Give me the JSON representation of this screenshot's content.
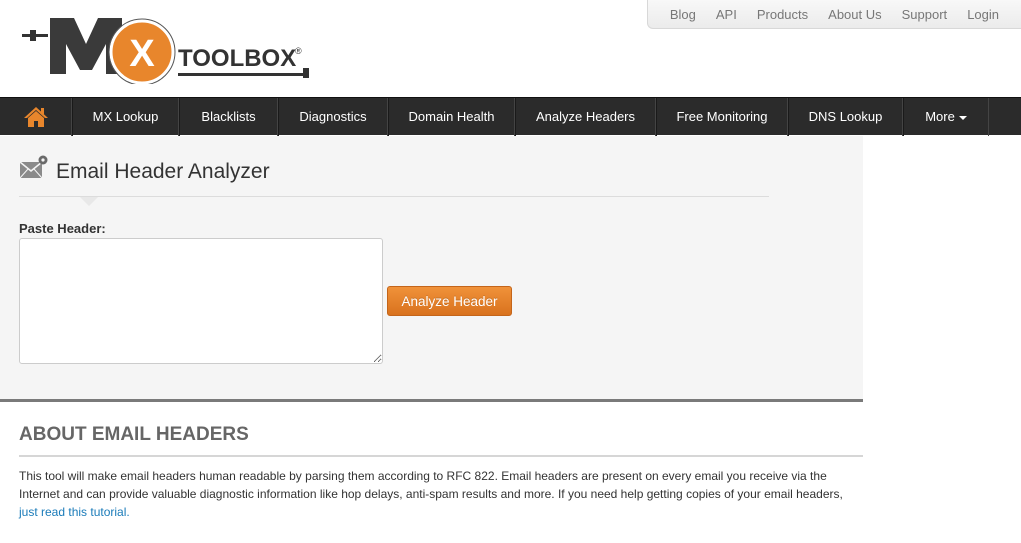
{
  "logo": {
    "mark": "MX",
    "text": "TOOLBOX",
    "registered": "®"
  },
  "topnav": [
    "Blog",
    "API",
    "Products",
    "About Us",
    "Support",
    "Login"
  ],
  "mainnav": {
    "home_icon": "home-icon",
    "items": [
      "MX Lookup",
      "Blacklists",
      "Diagnostics",
      "Domain Health",
      "Analyze Headers",
      "Free Monitoring",
      "DNS Lookup",
      "More"
    ]
  },
  "tool": {
    "title": "Email Header Analyzer",
    "paste_label": "Paste Header:",
    "input_value": "",
    "button_label": "Analyze Header"
  },
  "about": {
    "title": "ABOUT EMAIL HEADERS",
    "text": "This tool will make email headers human readable by parsing them according to RFC 822.  Email headers are present on every email you receive via the Internet and can provide valuable diagnostic information like hop delays, anti-spam results and more. If you need help getting copies of your email headers, ",
    "link": "just read this tutorial."
  },
  "colors": {
    "accent": "#e0812a",
    "nav_bg": "#2b2b2b",
    "link": "#1a7bb9"
  }
}
